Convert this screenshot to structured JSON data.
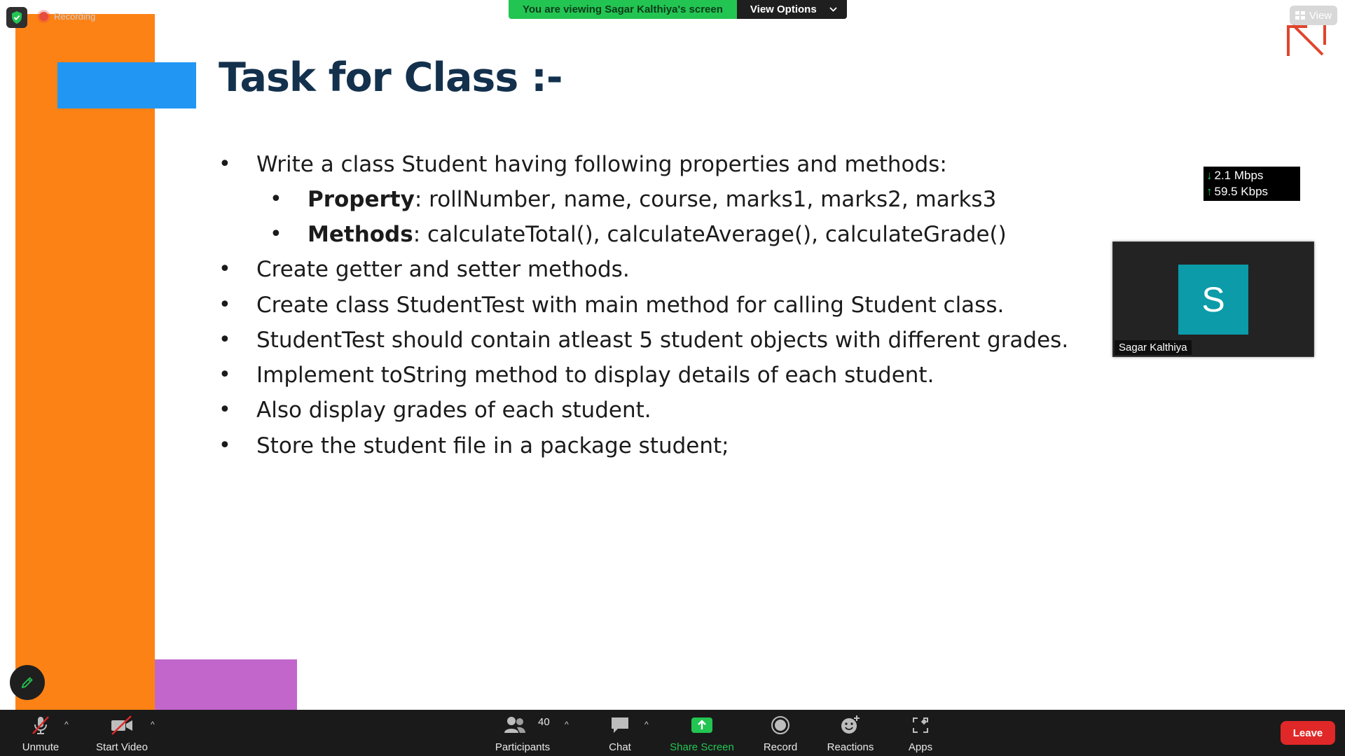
{
  "top_bar": {
    "recording_label": "Recording",
    "viewing_banner": "You are viewing Sagar Kalthiya's screen",
    "view_options_label": "View Options",
    "view_label": "View"
  },
  "slide": {
    "title": "Task for Class :-",
    "bullets": [
      {
        "text": "Write a class Student having following properties and methods:"
      },
      {
        "bold": "Property",
        "text": ": rollNumber, name, course, marks1, marks2, marks3"
      },
      {
        "bold": "Methods",
        "text": ": calculateTotal(), calculateAverage(), calculateGrade()"
      },
      {
        "text": "Create getter and setter methods."
      },
      {
        "text": "Create class StudentTest with main method for calling Student class."
      },
      {
        "text": "StudentTest should contain atleast 5 student objects with different grades."
      },
      {
        "text": "Implement toString method to display details of each student."
      },
      {
        "text": "Also display grades of each student."
      },
      {
        "text": "Store the student file in a package student;"
      }
    ],
    "bullet_symbol": "•",
    "colors": {
      "title": "#13314d",
      "orange": "#fd8215",
      "blue": "#2196f3",
      "purple": "#c266cc"
    }
  },
  "network_stats": {
    "download": "2.1 Mbps",
    "upload": "59.5 Kbps",
    "down_arrow": "↓",
    "up_arrow": "↑"
  },
  "video_tile": {
    "avatar_letter": "S",
    "name": "Sagar Kalthiya",
    "avatar_color": "#0b9ba9"
  },
  "toolbar": {
    "unmute": "Unmute",
    "start_video": "Start Video",
    "participants": "Participants",
    "participants_count": "40",
    "chat": "Chat",
    "share_screen": "Share Screen",
    "record": "Record",
    "reactions": "Reactions",
    "apps": "Apps",
    "leave": "Leave",
    "caret": "^"
  },
  "icons": {
    "security": "shield-icon",
    "recording": "record-dot-icon",
    "view": "grid-icon",
    "annotate": "pencil-icon",
    "mic": "microphone-muted-icon",
    "video": "camera-off-icon",
    "participants": "people-icon",
    "chat": "chat-bubble-icon",
    "share": "share-arrow-icon",
    "record": "record-icon",
    "reactions": "smiley-icon",
    "apps": "apps-icon",
    "chevron": "chevron-down-icon"
  },
  "accent_colors": {
    "green": "#23c552",
    "leave_red": "#e02828",
    "toolbar_bg": "#1a1a1a"
  }
}
